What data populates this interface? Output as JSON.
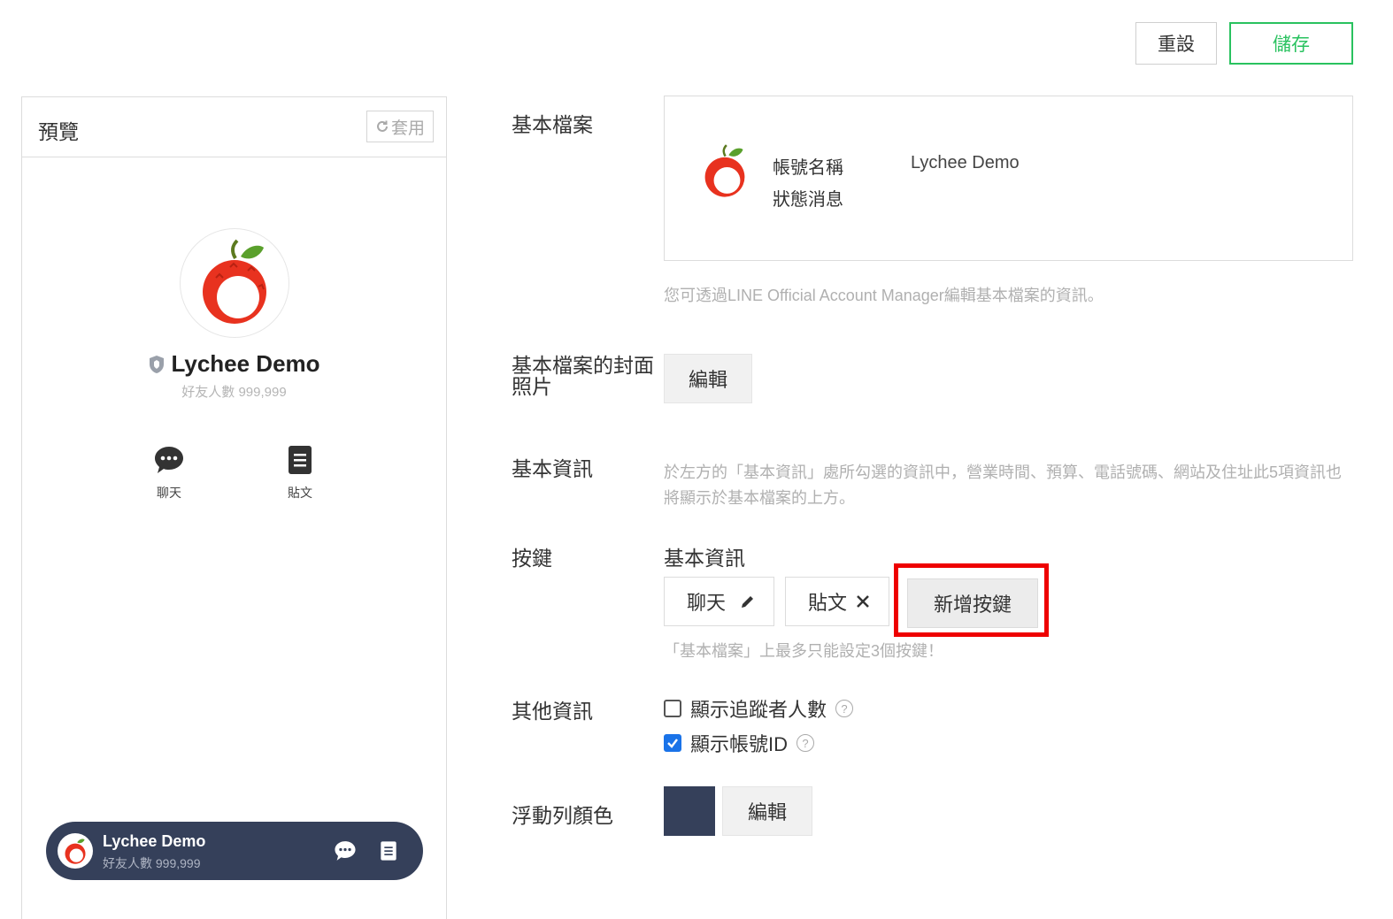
{
  "toolbar": {
    "reset_label": "重設",
    "save_label": "儲存"
  },
  "preview": {
    "title": "預覽",
    "apply_label": "套用",
    "account_name": "Lychee Demo",
    "friends_text": "好友人數 999,999",
    "buttons": [
      {
        "label": "聊天",
        "icon": "chat-bubble-icon"
      },
      {
        "label": "貼文",
        "icon": "post-document-icon"
      }
    ],
    "float_bar": {
      "name": "Lychee Demo",
      "friends": "好友人數 999,999",
      "color": "#35405a"
    }
  },
  "sections": {
    "basic_profile": {
      "label": "基本檔案",
      "fields": [
        {
          "key": "帳號名稱",
          "value": "Lychee Demo"
        },
        {
          "key": "狀態消息",
          "value": ""
        }
      ],
      "hint": "您可透過LINE Official Account Manager編輯基本檔案的資訊。"
    },
    "cover_photo": {
      "label": "基本檔案的封面照片",
      "edit_label": "編輯"
    },
    "basic_info": {
      "label": "基本資訊",
      "hint_line1": "於左方的「基本資訊」處所勾選的資訊中，營業時間、預算、電話號碼、網站及住址此5項資訊也",
      "hint_line2": "將顯示於基本檔案的上方。"
    },
    "buttons": {
      "label": "按鍵",
      "subtitle": "基本資訊",
      "items": [
        {
          "label": "聊天",
          "action_icon": "pencil-icon"
        },
        {
          "label": "貼文",
          "action_icon": "close-icon"
        }
      ],
      "add_label": "新增按鍵",
      "hint": "「基本檔案」上最多只能設定3個按鍵！"
    },
    "other_info": {
      "label": "其他資訊",
      "options": [
        {
          "label": "顯示追蹤者人數",
          "checked": false
        },
        {
          "label": "顯示帳號ID",
          "checked": true
        }
      ]
    },
    "float_color": {
      "label": "浮動列顏色",
      "color": "#35405a",
      "edit_label": "編輯"
    }
  },
  "colors": {
    "accent_green": "#29c25f",
    "highlight_red": "#ee0000",
    "checkbox_blue": "#1a73e8"
  }
}
